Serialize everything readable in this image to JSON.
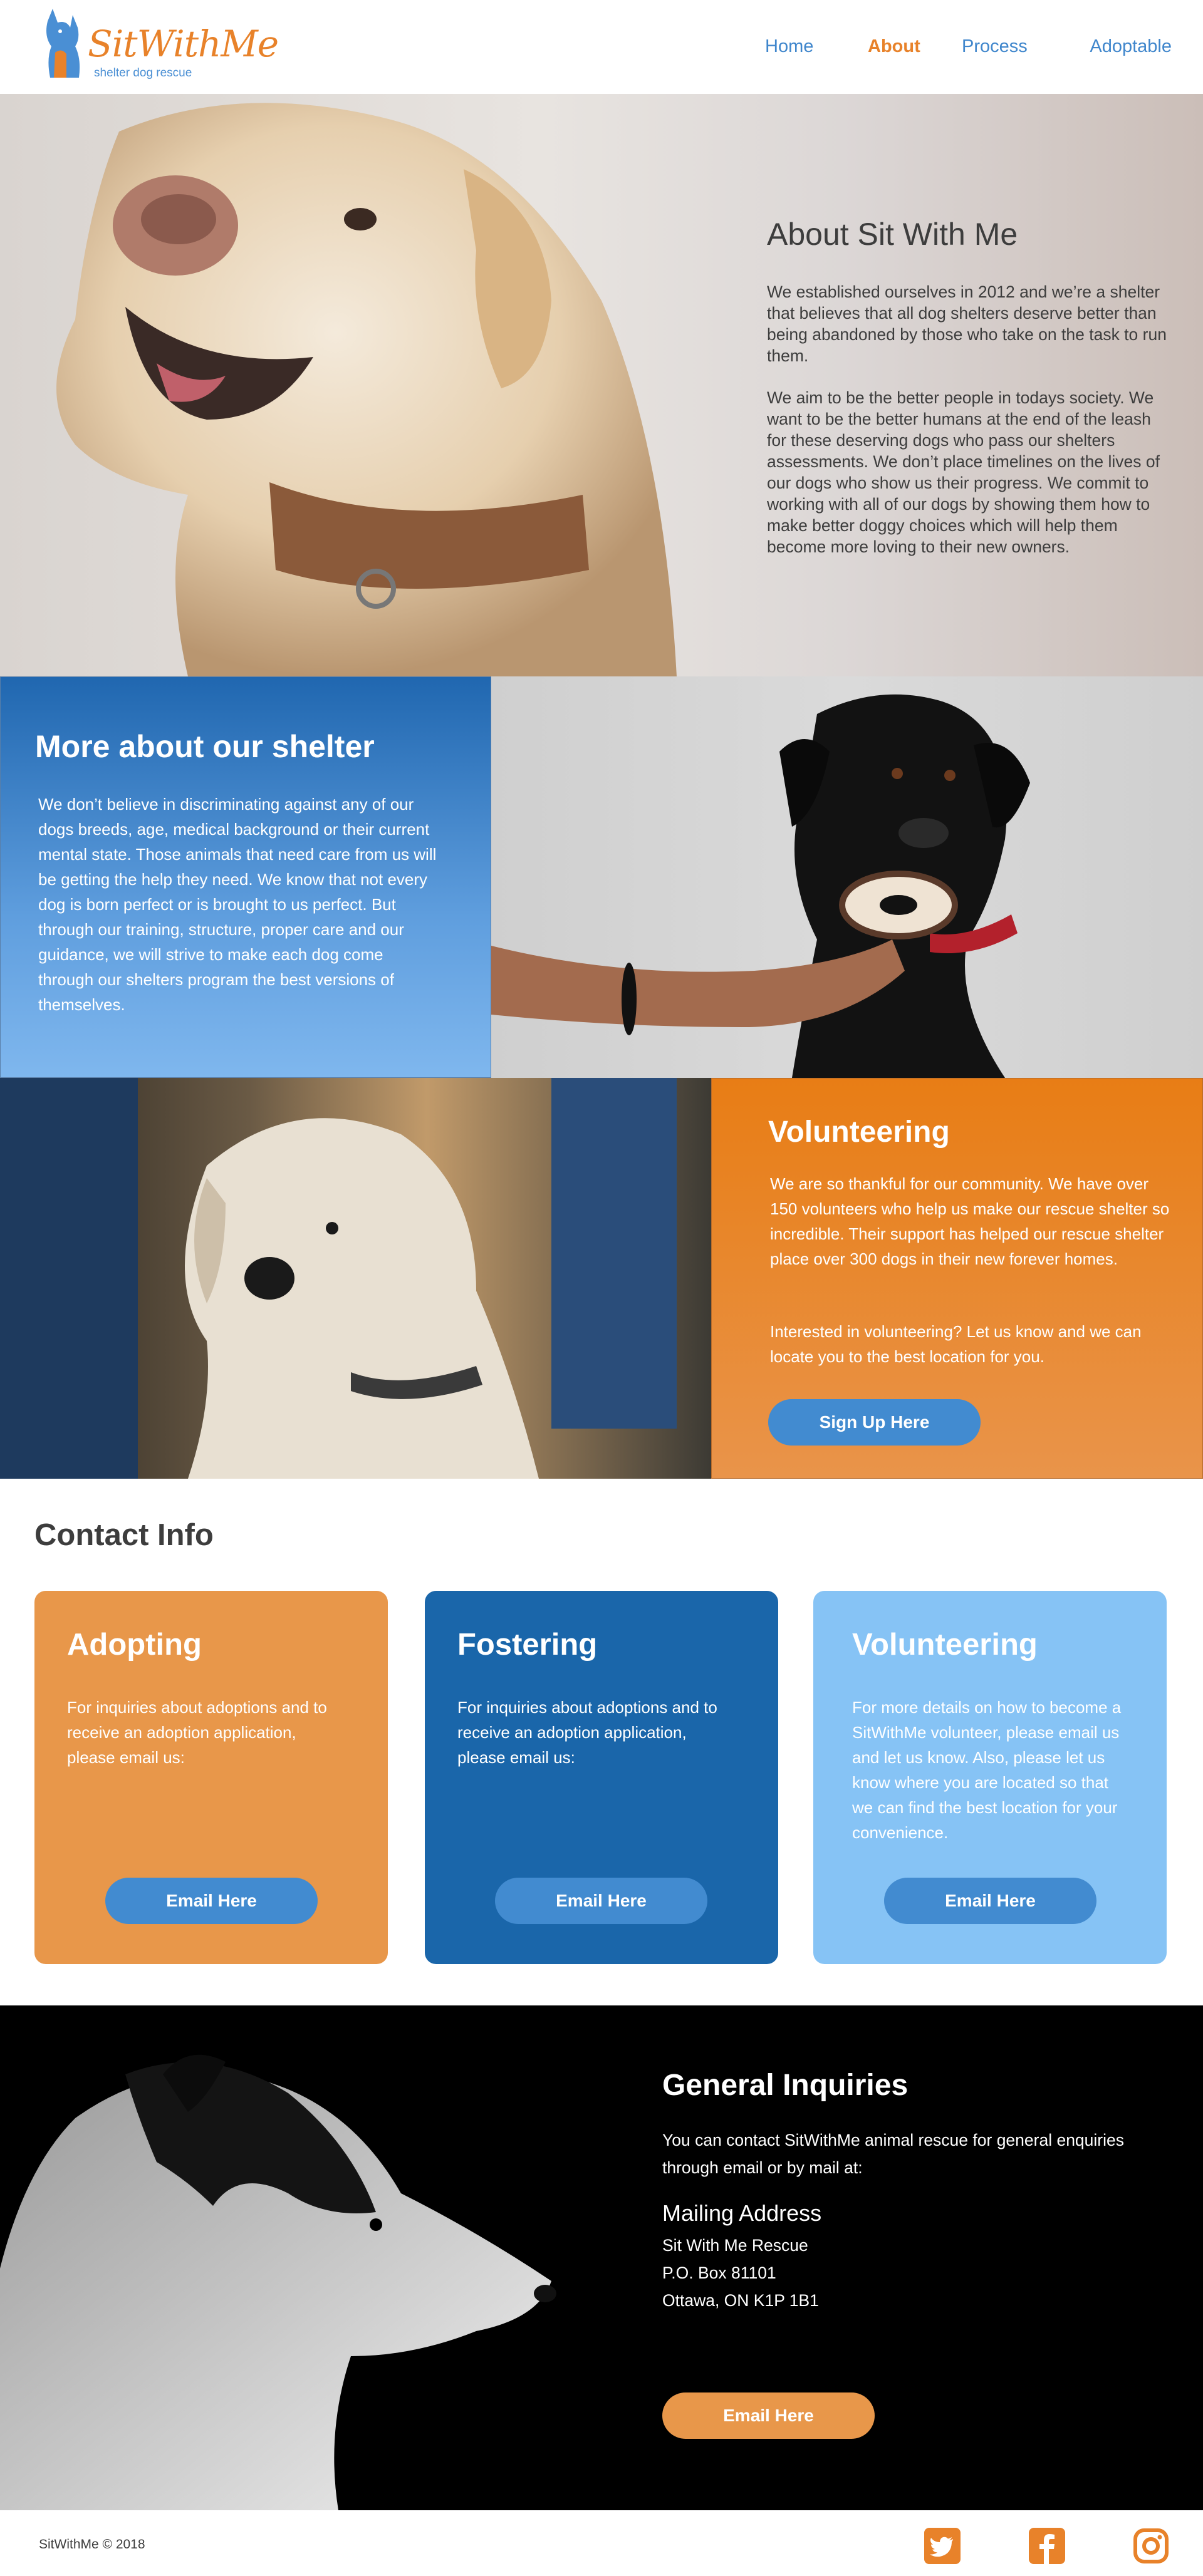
{
  "brand": {
    "name": "SitWithMe",
    "tagline": "shelter dog rescue",
    "accent": "#e8822a",
    "blue": "#428bd0"
  },
  "nav": {
    "home": "Home",
    "about": "About",
    "process": "Process",
    "adoptable": "Adoptable",
    "active": "About"
  },
  "about": {
    "title": "About Sit With Me",
    "p1": "We established ourselves in 2012 and we’re a shelter that believes that all dog shelters deserve better than being abandoned by those who take on the task to run them.",
    "p2": "We aim to be the better people in todays society. We want to be the better humans at the end of the leash for these deserving dogs who pass our shelters assessments. We don’t place timelines on the lives of our dogs who show us their progress. We commit to working with all of our dogs by showing them how to make better doggy choices which will help them become more loving to their new owners."
  },
  "more": {
    "title": "More about our shelter",
    "text": "We don’t believe in discriminating against any of our dogs breeds, age, medical background or their current mental state. Those animals that need care from us will be getting the help they need. We know that not every dog is born perfect or is brought to us perfect. But through our training, structure, proper care and our guidance, we will strive to make each dog come through our shelters program the best versions of themselves."
  },
  "volunteering": {
    "title": "Volunteering",
    "p1": "We are so thankful for our community. We have over 150 volunteers who help us make our rescue shelter so incredible. Their support has helped our rescue shelter place over 300 dogs in their new forever homes.",
    "p2": "Interested in volunteering? Let us know and we can locate you to the best location for you.",
    "button": "Sign Up Here"
  },
  "contact": {
    "title": "Contact Info",
    "cards": [
      {
        "title": "Adopting",
        "text": "For inquiries about adoptions and to receive an adoption application, please email us:",
        "button": "Email Here",
        "color": "#e8974a"
      },
      {
        "title": "Fostering",
        "text": "For inquiries about adoptions and to receive an adoption application, please email us:",
        "button": "Email Here",
        "color": "#1a66aa"
      },
      {
        "title": "Volunteering",
        "text": "For more details on how to become a SitWithMe volunteer, please email us and let us know. Also, please let us know where you are located so that we can find the best location for your convenience.",
        "button": "Email Here",
        "color": "#86c3f5"
      }
    ]
  },
  "general": {
    "title": "General Inquiries",
    "text": "You can contact SitWithMe animal rescue for general enquiries through email or by mail at:",
    "mailing_title": "Mailing Address",
    "address": [
      "Sit With Me Rescue",
      "P.O. Box 81101",
      "Ottawa, ON K1P 1B1"
    ],
    "button": "Email Here"
  },
  "footer": {
    "copyright": "SitWithMe © 2018",
    "social": [
      "twitter-icon",
      "facebook-icon",
      "instagram-icon"
    ]
  }
}
